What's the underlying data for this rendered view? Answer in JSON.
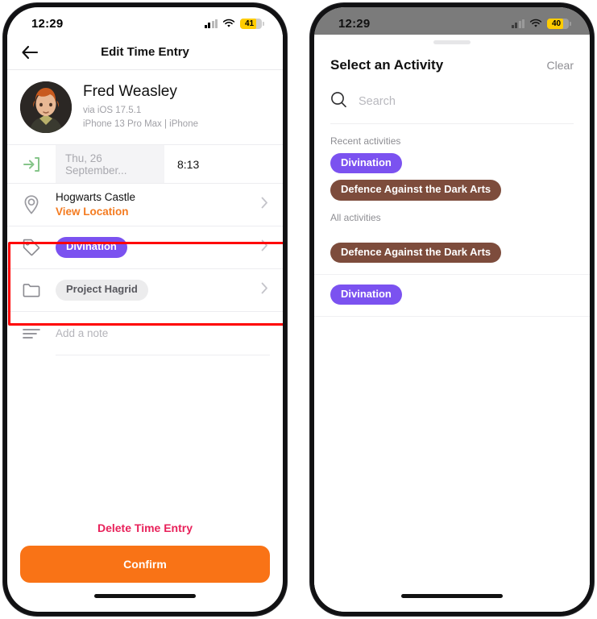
{
  "left_phone": {
    "status_bar": {
      "time": "12:29",
      "battery_level": "41",
      "wifi_icon": "wifi-icon",
      "signal_icon": "cellular-signal-icon"
    },
    "navbar": {
      "title": "Edit Time Entry",
      "back_icon": "back-arrow-icon"
    },
    "profile": {
      "name": "Fred Weasley",
      "via": "via iOS 17.5.1",
      "device": "iPhone 13 Pro Max | iPhone",
      "avatar_icon": "avatar"
    },
    "time_row": {
      "clock_in_icon": "clock-in-arrow-icon",
      "date": "Thu, 26 September...",
      "time": "8:13"
    },
    "location_row": {
      "icon": "location-pin-icon",
      "title": "Hogwarts Castle",
      "link": "View Location",
      "chevron_icon": "chevron-right-icon"
    },
    "activity_row": {
      "icon": "tag-icon",
      "chip": "Divination",
      "chip_color": "#7b52f0",
      "chevron_icon": "chevron-right-icon"
    },
    "project_row": {
      "icon": "folder-icon",
      "chip": "Project Hagrid",
      "chip_color": "#ececed",
      "chevron_icon": "chevron-right-icon"
    },
    "note_row": {
      "icon": "note-lines-icon",
      "placeholder": "Add a note"
    },
    "delete_label": "Delete Time Entry",
    "confirm_label": "Confirm",
    "confirm_color": "#f97316",
    "delete_color": "#e8215a"
  },
  "highlight": {
    "color": "#ff0000",
    "name": "highlight-box"
  },
  "right_phone": {
    "status_bar": {
      "time": "12:29",
      "battery_level": "40",
      "wifi_icon": "wifi-icon",
      "signal_icon": "cellular-signal-icon"
    },
    "sheet": {
      "title": "Select an Activity",
      "clear_label": "Clear",
      "search": {
        "icon": "search-icon",
        "placeholder": "Search",
        "value": ""
      },
      "recent_label": "Recent activities",
      "recent_chips": [
        {
          "label": "Divination",
          "color": "#7b52f0"
        },
        {
          "label": "Defence Against the Dark Arts",
          "color": "#7d4c3c"
        }
      ],
      "all_label": "All activities",
      "all_chips": [
        {
          "label": "Defence Against the Dark Arts",
          "color": "#7d4c3c"
        },
        {
          "label": "Divination",
          "color": "#7b52f0"
        }
      ]
    }
  }
}
